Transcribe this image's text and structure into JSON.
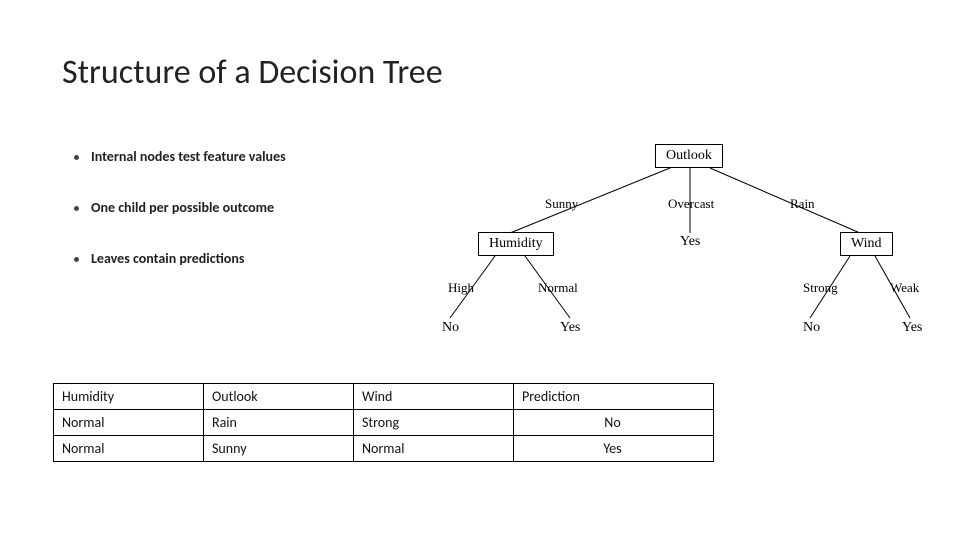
{
  "title": "Structure of a Decision Tree",
  "bullets": [
    "Internal nodes test feature values",
    "One child per possible outcome",
    "Leaves contain predictions"
  ],
  "tree": {
    "root": "Outlook",
    "branches": {
      "sunny": {
        "label": "Sunny",
        "node": "Humidity",
        "children": {
          "high": {
            "label": "High",
            "leaf": "No"
          },
          "normal": {
            "label": "Normal",
            "leaf": "Yes"
          }
        }
      },
      "overcast": {
        "label": "Overcast",
        "leaf": "Yes"
      },
      "rain": {
        "label": "Rain",
        "node": "Wind",
        "children": {
          "strong": {
            "label": "Strong",
            "leaf": "No"
          },
          "weak": {
            "label": "Weak",
            "leaf": "Yes"
          }
        }
      }
    }
  },
  "table": {
    "headers": [
      "Humidity",
      "Outlook",
      "Wind",
      "Prediction"
    ],
    "rows": [
      [
        "Normal",
        "Rain",
        "Strong",
        "No"
      ],
      [
        "Normal",
        "Sunny",
        "Normal",
        "Yes"
      ]
    ]
  }
}
